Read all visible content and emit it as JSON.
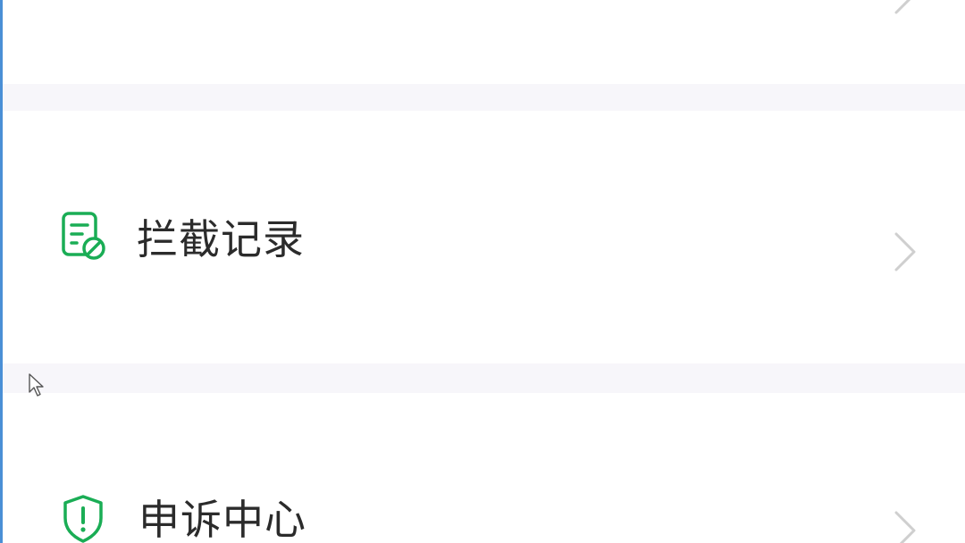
{
  "list": {
    "items": [
      {
        "label": "拦截记录",
        "icon": "document-block-icon"
      },
      {
        "label": "申诉中心",
        "icon": "shield-exclamation-icon"
      }
    ]
  },
  "colors": {
    "accent": "#1aad55",
    "separator": "#f7f6fa",
    "text": "#2b2b2b",
    "chevron": "#cfcfcf",
    "left_edge": "#4a8fd6"
  }
}
